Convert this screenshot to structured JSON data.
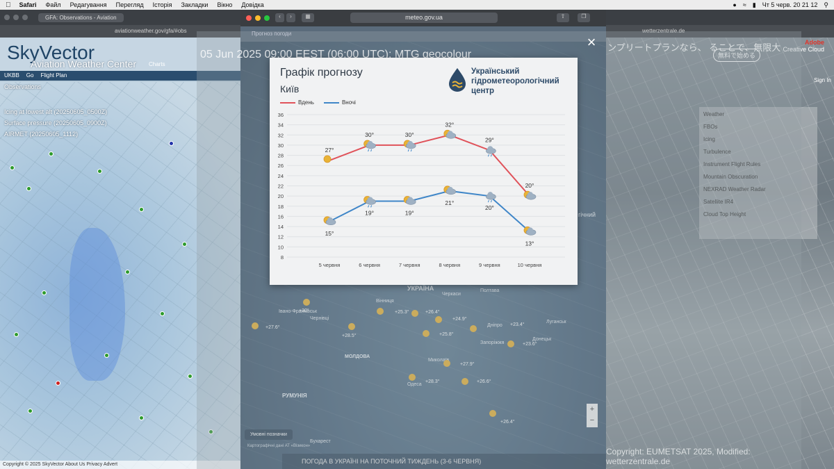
{
  "menubar": {
    "apple": "",
    "app": "Safari",
    "items": [
      "Файл",
      "Редагування",
      "Перегляд",
      "Історія",
      "Закладки",
      "Вікно",
      "Довідка"
    ],
    "clock": "Чт 5 черв. 20 21 12"
  },
  "left_browser": {
    "tab_title": "GFA: Observations - Aviation",
    "url": "aviationweather.gov/gfa/#obs",
    "logo": "SkyVector",
    "sub_title": "Aviation Weather Center",
    "charts_label": "Charts",
    "nav": {
      "airport": "UKBB",
      "go": "Go",
      "flight_plan": "Flight Plan"
    },
    "layers": [
      "Observations",
      "Icing at lowest alt (20250605_0500Z)",
      "Surface pressure (20250605_0900Z)",
      "AIRMET (20250605_1112)"
    ],
    "footer": "Copyright © 2025 SkyVector  About Us  Privacy  Advert"
  },
  "right_browser": {
    "url": "wetterzentrale.de",
    "jp_text": "ンプリートプランなら、 ることで、無限大",
    "jp_button": "無料で始める",
    "adobe_brand": "Adobe",
    "adobe_product": "Creative Cloud",
    "signin": "Sign In",
    "panel_items": [
      "Weather",
      "FBOs",
      "Icing",
      "Turbulence",
      "Instrument Flight Rules",
      "Mountain Obscuration",
      "NEXRAD Weather Radar",
      "Satellite IR4",
      "Cloud Top Height"
    ],
    "copyright": "Copyright: EUMETSAT 2025, Modified: wetterzentrale.de"
  },
  "overlay": {
    "date_text": "05 Jun 2025 09:00 EEST (06:00 UTC): MTG geocolour",
    "close_icon": "×"
  },
  "center_window": {
    "url": "meteo.gov.ua",
    "site_tabs": [
      "Прогноз погоди",
      "",
      ""
    ],
    "map_countries": [
      "УКРАЇНА",
      "МОЛДОВА",
      "РУМУНІЯ"
    ],
    "map_cities": [
      "Вінниця",
      "Черкаси",
      "Полтава",
      "Дніпро",
      "Запоріжжя",
      "Одеса",
      "Миколаїв",
      "Донецьк",
      "Луганськ",
      "Чернівці",
      "Івано-Франківськ",
      "Бухарест"
    ],
    "map_temps": [
      "+30°",
      "+25.3°",
      "+26.4°",
      "+24.9°",
      "+23.4°",
      "+25.8°",
      "+27.9°",
      "+28.3°",
      "+26.6°",
      "+26.4°",
      "+23.6°",
      "+27.6°",
      "+28.5°"
    ],
    "legend_button": "Умовні позначки",
    "attribution": "Картографічні дані АТ «Візикон»",
    "zoom_plus": "+",
    "zoom_minus": "−",
    "news_headline": "ПОГОДА В УКРАЇНІ НА ПОТОЧНИЙ ТИЖДЕНЬ (3-6 ЧЕРВНЯ)",
    "map_label_right": "гічний"
  },
  "forecast_card": {
    "title": "Графік прогнозу",
    "city": "Київ",
    "org_name": "Український гідрометеорологічний центр",
    "legend_day": "Вдень",
    "legend_night": "Вночі",
    "colors": {
      "day": "#e0525a",
      "night": "#3f86c8",
      "grid": "#dfe2e5",
      "text": "#2f3a46"
    }
  },
  "chart_data": {
    "type": "line",
    "title": "Графік прогнозу",
    "subtitle": "Київ",
    "categories": [
      "5 червня",
      "6 червня",
      "7 червня",
      "8 червня",
      "9 червня",
      "10 червня"
    ],
    "series": [
      {
        "name": "Вдень",
        "values": [
          27,
          30,
          30,
          32,
          29,
          20
        ],
        "labels": [
          "27°",
          "30°",
          "30°",
          "32°",
          "29°",
          "20°"
        ],
        "icons": [
          "sun",
          "sun-cloud-rain",
          "sun-cloud-rain",
          "sun-cloud",
          "cloud-rain",
          "sun-cloud"
        ]
      },
      {
        "name": "Вночі",
        "values": [
          15,
          19,
          19,
          21,
          20,
          13
        ],
        "labels": [
          "15°",
          "19°",
          "19°",
          "21°",
          "20°",
          "13°"
        ],
        "icons": [
          "sun-cloud",
          "sun-cloud-rain",
          "sun-cloud",
          "sun-cloud",
          "cloud-rain",
          "sun-cloud"
        ]
      }
    ],
    "yticks": [
      8,
      10,
      12,
      14,
      16,
      18,
      20,
      22,
      24,
      26,
      28,
      30,
      32,
      34,
      36
    ],
    "ylim": [
      8,
      36
    ],
    "grid": true,
    "legend_position": "top-left"
  }
}
